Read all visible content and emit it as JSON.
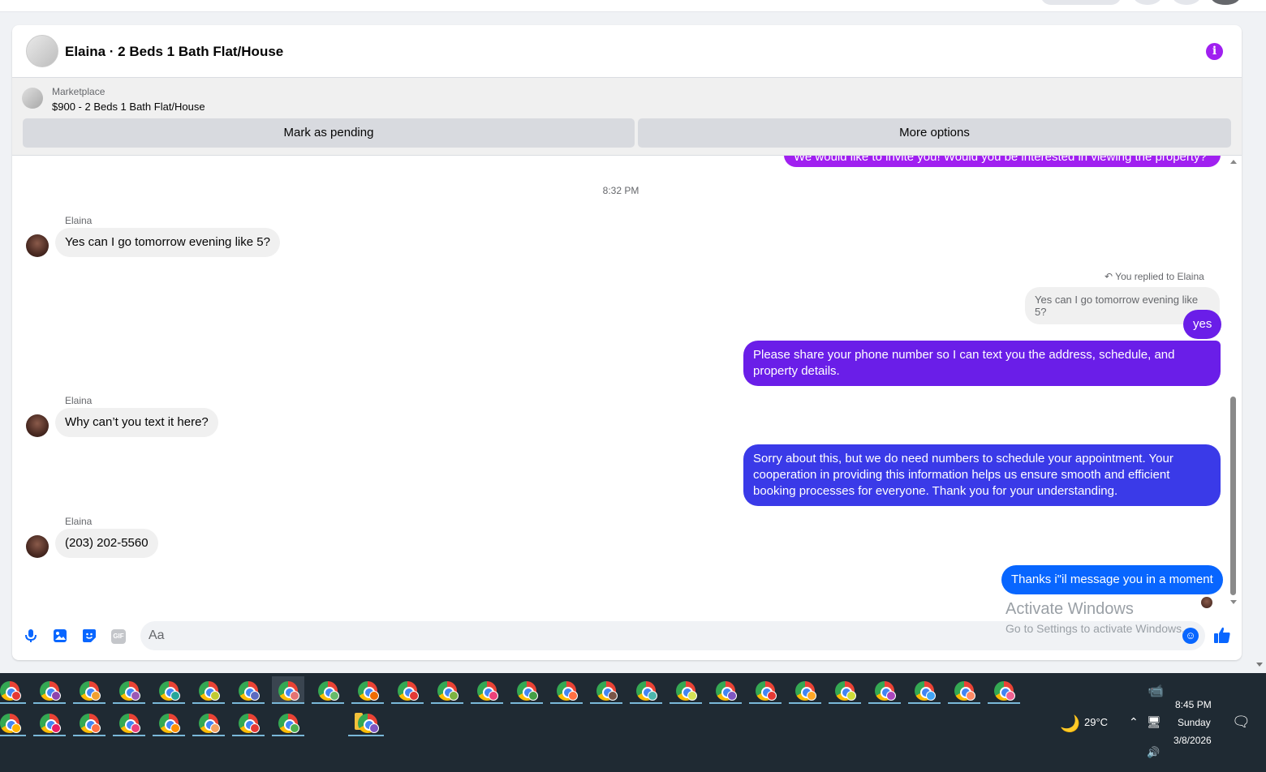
{
  "chat": {
    "title": "Elaina · 2 Beds 1 Bath Flat/House",
    "info_icon": "info-icon"
  },
  "listing": {
    "source": "Marketplace",
    "price_title": "$900 - 2 Beds 1 Bath Flat/House",
    "pending_label": "Mark as pending",
    "more_label": "More options"
  },
  "messages": {
    "cut_off_outgoing": "We would like to invite you! Would you be interested in viewing the property?",
    "timestamp": "8:32 PM",
    "sender_name": "Elaina",
    "msg1": "Yes can I go tomorrow evening like 5?",
    "reply_note": "You replied to Elaina",
    "reply_quote": "Yes can I go tomorrow evening like 5?",
    "msg_yes": "yes",
    "msg_share": "Please share your phone number so I can text you the address, schedule, and property details.",
    "msg2": "Why can’t you text it here?",
    "msg_sorry": "Sorry about this, but we do need numbers to schedule your appointment. Your cooperation in providing this information helps us ensure smooth and efficient booking processes for everyone. Thank you for your understanding.",
    "msg3": "(203) 202-5560",
    "msg_thanks": "Thanks i\"il message you in a moment"
  },
  "composer": {
    "placeholder": "Aa"
  },
  "watermark": {
    "line1": "Activate Windows",
    "line2": "Go to Settings to activate Windows."
  },
  "taskbar": {
    "weather": "29°C",
    "time": "8:45 PM",
    "day": "Sunday",
    "date": "3/8/2026",
    "profile_badge_colors": [
      "#e53935",
      "#8e44ad",
      "#f0a030",
      "#9b59b6",
      "#26a69a",
      "#c0ca33",
      "#5c6bc0",
      "#e57373",
      "#66bb6a",
      "#ef6c00",
      "#e53935",
      "#7cb342",
      "#ec407a",
      "#43a047",
      "#ff7043",
      "#795548",
      "#4db6ac",
      "#d4e157",
      "#7e57c2",
      "#e53935",
      "#ffa726",
      "#cddc39",
      "#ab47bc",
      "#42a5f5",
      "#ff8a65",
      "#f06292"
    ],
    "row2_badge_colors": [
      "#ffb300",
      "#e91e63",
      "#ff7043",
      "#ec407a",
      "#ff8f00",
      "#f4a261",
      "#e53935",
      "#4caf50",
      "#7e57c2"
    ]
  },
  "colors": {
    "messenger_purple": "#a020f0",
    "bubble_violet": "#6a1ee8",
    "bubble_indigo": "#3a3ae8",
    "bubble_blue": "#0866ff"
  }
}
